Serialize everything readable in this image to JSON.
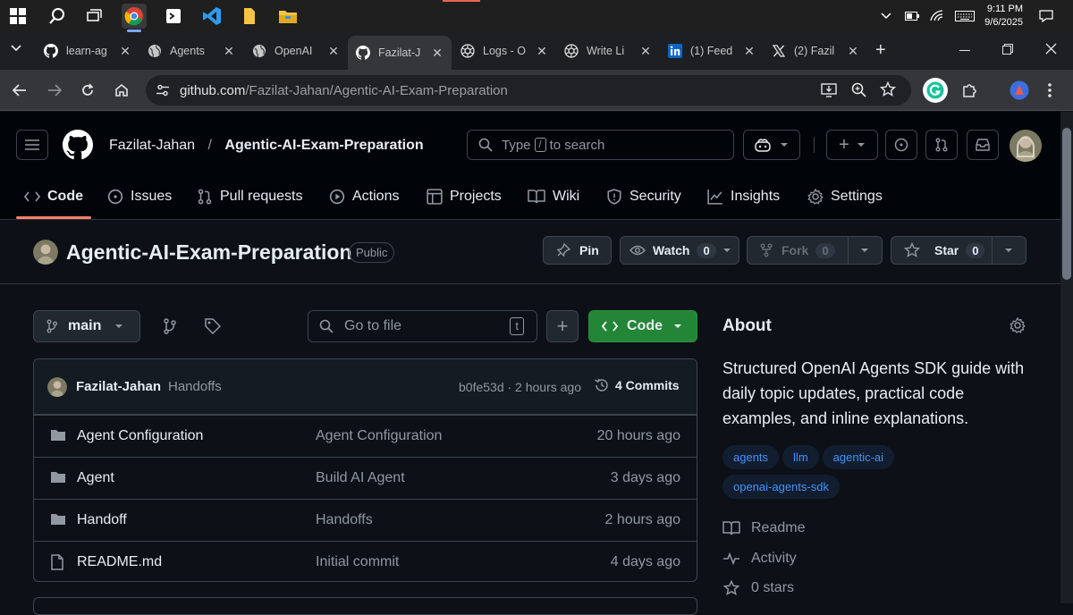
{
  "taskbar": {
    "time": "9:11 PM",
    "date": "9/6/2025",
    "icons": [
      "windows-icon",
      "search-icon",
      "task-view-icon",
      "chrome-icon",
      "terminal-icon",
      "vscode-icon",
      "file-icon",
      "file-explorer-icon"
    ]
  },
  "tabs": [
    {
      "label": "learn-ag",
      "icon": "github-icon"
    },
    {
      "label": "Agents",
      "icon": "globe-icon"
    },
    {
      "label": "OpenAI",
      "icon": "globe-icon"
    },
    {
      "label": "Fazilat-J",
      "icon": "github-icon",
      "active": true
    },
    {
      "label": "Logs - O",
      "icon": "openai-icon"
    },
    {
      "label": "Write Li",
      "icon": "openai-icon"
    },
    {
      "label": "(1) Feed",
      "icon": "linkedin-icon"
    },
    {
      "label": "(2) Fazil",
      "icon": "x-icon"
    }
  ],
  "address": {
    "domain": "github.com",
    "path": "/Fazilat-Jahan/Agentic-AI-Exam-Preparation"
  },
  "header": {
    "owner": "Fazilat-Jahan",
    "separator": "/",
    "repo": "Agentic-AI-Exam-Preparation",
    "search_prefix": "Type",
    "search_key": "/",
    "search_suffix": "to search"
  },
  "reponav": [
    {
      "label": "Code",
      "icon": "code-icon"
    },
    {
      "label": "Issues",
      "icon": "issue-icon"
    },
    {
      "label": "Pull requests",
      "icon": "pull-request-icon"
    },
    {
      "label": "Actions",
      "icon": "play-icon"
    },
    {
      "label": "Projects",
      "icon": "table-icon"
    },
    {
      "label": "Wiki",
      "icon": "book-icon"
    },
    {
      "label": "Security",
      "icon": "shield-icon"
    },
    {
      "label": "Insights",
      "icon": "graph-icon"
    },
    {
      "label": "Settings",
      "icon": "gear-icon"
    }
  ],
  "repo": {
    "title": "Agentic-AI-Exam-Preparation",
    "visibility": "Public",
    "pin_label": "Pin",
    "watch_label": "Watch",
    "watch_count": "0",
    "fork_label": "Fork",
    "fork_count": "0",
    "star_label": "Star",
    "star_count": "0"
  },
  "browser": {
    "branch": "main",
    "go_to_file": "Go to file",
    "go_to_file_key": "t",
    "code_button": "Code"
  },
  "commit": {
    "author": "Fazilat-Jahan",
    "message": "Handoffs",
    "hash_time": "b0fe53d · 2 hours ago",
    "commits": "4 Commits"
  },
  "files": [
    {
      "name": "Agent Configuration",
      "message": "Agent Configuration",
      "time": "20 hours ago",
      "type": "folder"
    },
    {
      "name": "Agent",
      "message": "Build AI Agent",
      "time": "3 days ago",
      "type": "folder"
    },
    {
      "name": "Handoff",
      "message": "Handoffs",
      "time": "2 hours ago",
      "type": "folder"
    },
    {
      "name": "README.md",
      "message": "Initial commit",
      "time": "4 days ago",
      "type": "file"
    }
  ],
  "about": {
    "heading": "About",
    "description": "Structured OpenAI Agents SDK guide with daily topic updates, practical code examples, and inline explanations.",
    "topics": [
      "agents",
      "llm",
      "agentic-ai",
      "openai-agents-sdk"
    ],
    "readme": "Readme",
    "activity": "Activity",
    "stars": "0 stars"
  },
  "colors": {
    "accent_green": "#238636",
    "link_blue": "#4493f8",
    "underline": "#f78166"
  }
}
